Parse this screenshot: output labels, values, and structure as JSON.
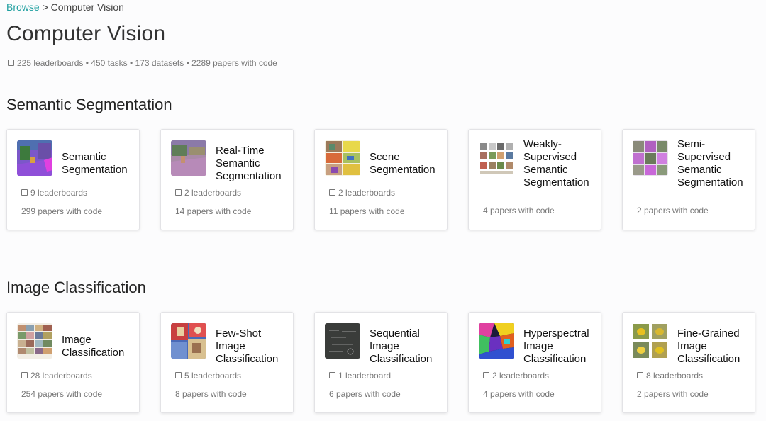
{
  "breadcrumb": {
    "link": "Browse",
    "separator": ">",
    "current": "Computer Vision"
  },
  "title": "Computer Vision",
  "stats": "225 leaderboards • 450 tasks • 173 datasets • 2289 papers with code",
  "sections": [
    {
      "title": "Semantic Segmentation",
      "cards": [
        {
          "title": "Semantic Segmentation",
          "leaderboards": "9 leaderboards",
          "papers": "299 papers with code",
          "thumb": "scene-purple-icon"
        },
        {
          "title": "Real-Time Semantic Segmentation",
          "leaderboards": "2 leaderboards",
          "papers": "14 papers with code",
          "thumb": "scene-blurred-icon"
        },
        {
          "title": "Scene Segmentation",
          "leaderboards": "2 leaderboards",
          "papers": "11 papers with code",
          "thumb": "segmentation-grid-icon"
        },
        {
          "title": "Weakly-Supervised Semantic Segmentation",
          "leaderboards": "",
          "papers": "4 papers with code",
          "thumb": "image-mosaic-icon"
        },
        {
          "title": "Semi-Supervised Semantic Segmentation",
          "leaderboards": "",
          "papers": "2 papers with code",
          "thumb": "mask-grid-icon"
        }
      ]
    },
    {
      "title": "Image Classification",
      "cards": [
        {
          "title": "Image Classification",
          "leaderboards": "28 leaderboards",
          "papers": "254 papers with code",
          "thumb": "photo-grid-icon"
        },
        {
          "title": "Few-Shot Image Classification",
          "leaderboards": "5 leaderboards",
          "papers": "8 papers with code",
          "thumb": "few-shot-collage-icon"
        },
        {
          "title": "Sequential Image Classification",
          "leaderboards": "1 leaderboard",
          "papers": "6 papers with code",
          "thumb": "chalkboard-icon"
        },
        {
          "title": "Hyperspectral Image Classification",
          "leaderboards": "2 leaderboards",
          "papers": "4 papers with code",
          "thumb": "hyperspectral-map-icon"
        },
        {
          "title": "Fine-Grained Image Classification",
          "leaderboards": "8 leaderboards",
          "papers": "2 papers with code",
          "thumb": "bird-grid-icon"
        }
      ]
    }
  ],
  "colors": {
    "link": "#21a0a0",
    "muted": "#777777",
    "text": "#222222"
  }
}
